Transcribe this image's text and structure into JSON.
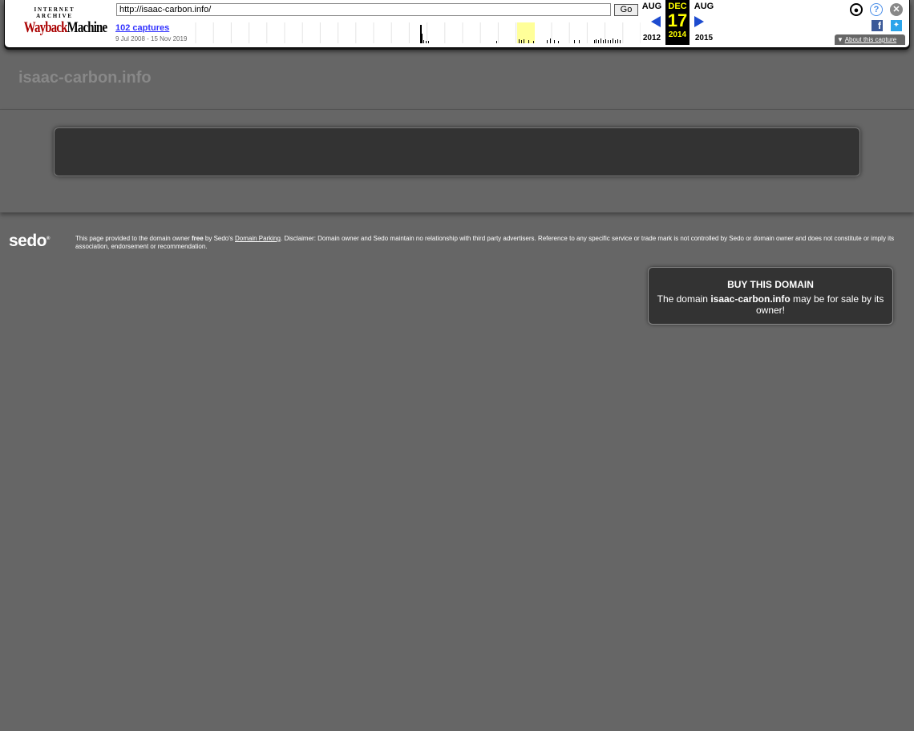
{
  "toolbar": {
    "logo_top": "INTERNET ARCHIVE",
    "logo_main_a": "Wayback",
    "logo_main_b": "Machine",
    "url_value": "http://isaac-carbon.info/",
    "go_label": "Go",
    "captures_link": "102 captures",
    "captures_range": "9 Jul 2008 - 15 Nov 2019",
    "prev_month": "AUG",
    "prev_year": "2012",
    "current_month": "DEC",
    "current_day": "17",
    "current_year": "2014",
    "next_month": "AUG",
    "next_year": "2015",
    "about_label": "About this capture",
    "icons": [
      "user-icon",
      "help-icon",
      "close-icon",
      "facebook-icon",
      "twitter-icon"
    ],
    "sparkline": {
      "capture_counts": [
        0,
        0,
        0,
        0,
        0,
        0,
        0,
        0,
        0,
        0,
        0,
        0,
        0,
        0,
        0,
        0,
        0,
        0,
        0,
        0,
        0,
        0,
        0,
        0,
        0,
        0,
        0,
        0,
        0,
        0,
        0,
        0,
        0,
        0,
        0,
        0,
        0,
        0,
        0,
        0,
        0,
        0,
        0,
        0,
        0,
        0,
        0,
        0,
        0,
        0,
        0,
        0,
        0,
        0,
        0,
        0,
        0,
        0,
        0,
        0,
        0,
        0,
        0,
        0,
        0,
        0,
        0,
        0,
        0,
        0,
        0,
        0,
        0,
        0,
        0,
        0,
        0,
        0,
        0,
        0,
        0,
        0,
        0,
        0,
        0,
        0,
        0,
        0,
        0,
        0,
        0,
        0,
        0,
        0,
        0,
        0,
        0,
        0,
        0,
        0,
        0,
        0,
        0,
        0,
        0,
        0,
        0,
        0,
        0,
        0,
        0,
        0,
        0,
        0,
        0,
        0,
        0,
        0,
        0,
        0,
        0,
        0,
        0,
        0,
        0,
        0,
        0,
        0,
        0,
        0,
        0,
        0,
        0,
        0,
        0,
        0,
        0,
        0,
        0,
        0,
        0,
        0,
        0,
        0,
        0,
        0,
        0,
        0,
        0,
        0,
        0,
        0,
        0,
        0,
        0,
        0,
        0,
        0,
        0,
        0,
        0,
        0,
        0,
        0,
        0,
        0,
        0,
        0,
        0,
        0,
        0,
        0,
        0,
        0,
        0,
        0,
        0,
        0,
        0,
        0,
        0,
        0,
        0,
        0,
        0,
        0,
        0,
        0,
        0,
        0,
        0,
        0,
        0,
        0,
        0,
        0,
        0,
        0,
        0,
        0,
        0,
        0,
        0,
        0,
        0,
        0,
        0,
        0,
        0,
        0,
        0,
        0,
        0,
        0,
        0,
        0,
        0,
        0,
        0,
        0,
        0,
        0,
        0,
        0,
        0,
        0,
        0,
        0,
        0,
        0,
        0,
        0,
        0,
        0,
        0,
        0,
        0,
        0,
        0,
        0,
        0,
        0,
        0,
        0,
        0,
        0,
        0,
        0,
        0,
        0,
        0,
        0,
        0,
        0,
        0,
        0,
        0,
        0,
        0,
        0,
        0,
        0,
        0,
        0,
        0,
        0,
        0,
        0,
        0,
        0,
        0,
        0,
        0,
        0,
        0,
        0,
        0,
        0,
        0,
        0,
        0,
        0,
        0,
        0,
        0,
        0,
        0,
        0,
        0,
        0,
        0,
        0,
        0,
        0,
        0,
        0,
        0,
        0,
        0,
        0,
        0,
        0,
        0,
        0,
        0,
        0,
        0,
        0,
        0,
        0,
        0,
        0,
        0,
        0,
        0,
        0,
        0,
        0,
        0,
        0,
        0,
        0,
        0,
        0,
        0,
        0,
        0,
        0,
        0,
        0,
        0,
        0,
        0,
        0,
        0,
        0,
        0,
        0,
        0,
        0,
        0,
        0,
        0,
        0,
        0,
        0,
        0,
        0,
        0,
        0,
        0,
        0,
        0,
        0,
        0,
        0,
        0,
        0,
        0,
        0,
        0,
        0,
        0,
        0,
        0,
        0,
        0,
        0,
        0,
        0,
        0,
        0,
        0,
        0,
        0,
        0,
        0,
        0,
        0,
        0,
        0,
        0,
        0,
        0,
        0,
        0,
        0,
        0,
        0,
        0,
        0,
        0,
        0,
        0,
        0,
        0,
        0,
        0,
        0,
        0,
        0,
        0,
        0,
        0,
        0,
        0,
        0,
        0,
        0,
        0,
        0,
        0,
        0,
        0,
        0,
        0,
        0,
        0,
        0,
        0,
        0,
        0,
        0,
        0,
        0,
        0,
        0,
        0,
        0,
        0,
        0,
        0,
        0,
        0,
        0,
        0,
        0,
        0,
        0,
        0,
        0,
        0,
        0,
        0,
        0,
        0,
        0,
        0,
        0,
        0,
        0,
        0,
        0,
        0,
        0,
        0,
        0,
        0,
        0,
        0,
        0,
        0,
        0,
        0,
        0,
        0,
        0,
        0,
        0,
        0,
        0,
        0,
        0,
        0,
        0,
        0,
        0,
        0,
        0,
        0,
        0,
        0,
        0,
        0,
        0,
        0,
        0,
        0,
        0,
        0,
        0,
        0,
        0,
        0,
        0,
        0,
        0,
        0,
        0,
        0,
        0,
        0,
        0,
        0,
        0,
        0,
        0,
        0,
        0,
        0,
        0,
        0,
        0,
        0,
        0,
        0,
        0,
        0,
        0,
        0,
        0,
        0,
        0,
        0,
        0,
        0,
        0,
        0,
        0,
        0,
        0,
        0,
        0,
        0,
        0,
        0,
        0,
        0,
        0,
        0,
        0,
        0,
        0,
        0,
        0,
        0,
        0,
        0,
        0,
        0,
        0,
        0,
        0,
        0,
        0,
        0,
        0,
        0,
        0,
        0,
        0,
        0,
        0,
        0,
        0,
        0,
        0,
        0,
        0,
        0,
        0,
        0,
        0,
        0,
        0,
        0,
        0,
        0,
        0,
        0,
        0,
        0,
        0,
        0,
        0,
        0,
        0,
        0,
        0,
        0,
        0,
        0,
        0,
        0,
        0,
        0,
        0,
        0,
        0,
        0,
        0,
        0,
        0,
        0,
        0,
        0,
        0,
        0,
        0,
        0,
        0,
        0,
        0,
        0,
        0,
        0,
        0,
        0
      ]
    }
  },
  "page": {
    "site_title": "isaac-carbon.info",
    "sedo_logo": "sedo",
    "disclaimer_pre": "This page provided to the domain owner ",
    "disclaimer_bold": "free",
    "disclaimer_mid": " by Sedo's ",
    "disclaimer_link": "Domain Parking",
    "disclaimer_post": ". Disclaimer: Domain owner and Sedo maintain no relationship with third party advertisers. Reference to any specific service or trade mark is not controlled by Sedo or domain owner and does not constitute or imply its association, endorsement or recommendation.",
    "buy_title": "BUY THIS DOMAIN",
    "buy_text_pre": "The domain ",
    "buy_text_domain": "isaac-carbon.info",
    "buy_text_post": " may be for sale by its owner!"
  },
  "colors": {
    "background": "#666666",
    "box": "#333333",
    "title_gray": "#888888",
    "wayback_blue": "#1d4bcf",
    "current_yellow": "#ffff00"
  }
}
